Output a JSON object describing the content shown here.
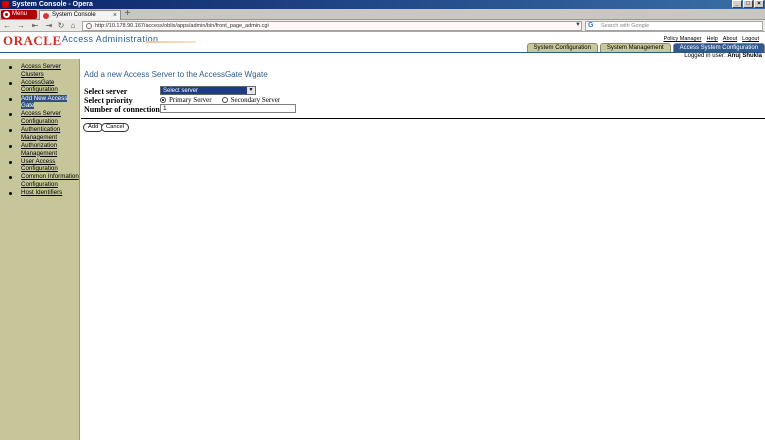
{
  "window": {
    "title": "System Console - Opera"
  },
  "browser": {
    "menu_label": "Menu",
    "tab_title": "System Console",
    "url": "http://10.178.90.167/access/oblix/apps/admin/bin/front_page_admin.cgi",
    "search_placeholder": "Search with Google"
  },
  "header": {
    "logo": "ORACLE",
    "app_title": "Access Administration",
    "links": [
      "Policy Manager",
      "Help",
      "About",
      "Logout"
    ],
    "tabs": [
      {
        "label": "System Configuration",
        "active": false
      },
      {
        "label": "System Management",
        "active": false
      },
      {
        "label": "Access System Configuration",
        "active": true
      }
    ],
    "logged_in_prefix": "Logged in user:",
    "logged_in_user": "Anuj Shukla"
  },
  "sidebar": {
    "items": [
      {
        "label": "Access Server Clusters",
        "active": false
      },
      {
        "label": "AccessGate Configuration",
        "active": false
      },
      {
        "label": "Add New Access Gate",
        "active": true
      },
      {
        "label": "Access Server Configuration",
        "active": false
      },
      {
        "label": "Authentication Management",
        "active": false
      },
      {
        "label": "Authorization Management",
        "active": false
      },
      {
        "label": "User Access Configuration",
        "active": false
      },
      {
        "label": "Common Information Configuration",
        "active": false
      },
      {
        "label": "Host Identifiers",
        "active": false
      }
    ]
  },
  "main": {
    "heading": "Add a new Access Server to the AccessGate Wgate",
    "select_server_label": "Select server",
    "select_server_value": "Select server",
    "select_priority_label": "Select priority",
    "priority_options": [
      {
        "label": "Primary Server",
        "checked": true
      },
      {
        "label": "Secondary Server",
        "checked": false
      }
    ],
    "connections_label": "Number of connections",
    "connections_value": "1",
    "add_button": "Add",
    "cancel_button": "Cancel"
  },
  "colors": {
    "sidebar_bg": "#c6c69a",
    "accent_blue": "#2f5b8c",
    "oracle_red": "#cc3322"
  }
}
